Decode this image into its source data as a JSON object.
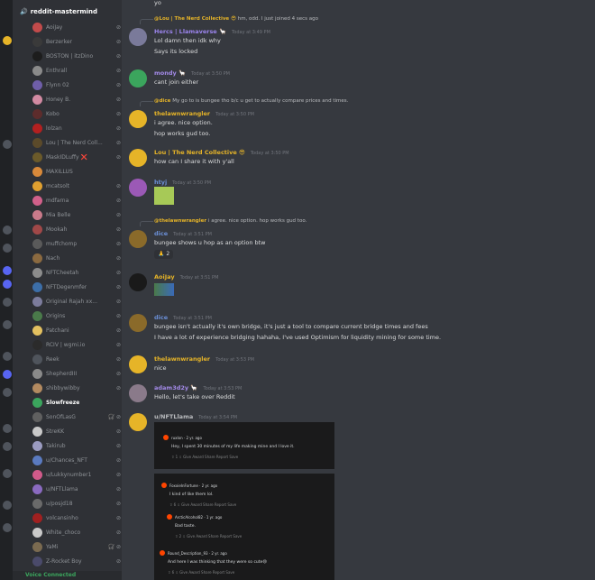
{
  "server": {
    "channel_name": "reddit-mastermind",
    "voice_users": [
      {
        "name": "AoiJay",
        "color": "#c24b4b",
        "muted": true
      },
      {
        "name": "Berzerker",
        "color": "#3a3a3a",
        "muted": true
      },
      {
        "name": "BOSTON | itzDino",
        "color": "#1d1d1d",
        "muted": true
      },
      {
        "name": "Enthrall",
        "color": "#8a8a8a",
        "muted": true
      },
      {
        "name": "Flynn 02",
        "color": "#6f5ea8",
        "muted": true
      },
      {
        "name": "Honey B.",
        "color": "#d28aa2",
        "muted": true
      },
      {
        "name": "Kobo",
        "color": "#5d2c2c",
        "muted": true
      },
      {
        "name": "lolzan",
        "color": "#b32020",
        "muted": true
      },
      {
        "name": "Lou | The Nerd Coll...",
        "color": "#5b4a2a",
        "muted": true
      },
      {
        "name": "MaskIDLuffy ❌",
        "color": "#6b5a2a",
        "muted": true
      },
      {
        "name": "MAXILLUS",
        "color": "#d8893a",
        "muted": false
      },
      {
        "name": "mcatsolt",
        "color": "#e0a030",
        "muted": true
      },
      {
        "name": "mdfarna",
        "color": "#d1608a",
        "muted": true
      },
      {
        "name": "Mia Belle",
        "color": "#c97a8a",
        "muted": true
      },
      {
        "name": "Mookah",
        "color": "#a04848",
        "muted": true
      },
      {
        "name": "muffchomp",
        "color": "#5a5a5a",
        "muted": true
      },
      {
        "name": "Nach",
        "color": "#8b6a40",
        "muted": true
      },
      {
        "name": "NFTCheetah",
        "color": "#8c8c8c",
        "muted": true
      },
      {
        "name": "NFTDegenmfer",
        "color": "#3c6ea8",
        "muted": true
      },
      {
        "name": "Original Rajah xx...",
        "color": "#7c7c9c",
        "muted": true
      },
      {
        "name": "Origins",
        "color": "#4a7a4a",
        "muted": true
      },
      {
        "name": "Patchani",
        "color": "#e3c060",
        "muted": true
      },
      {
        "name": "RCIV | wgmi.io",
        "color": "#2b2b2b",
        "muted": true
      },
      {
        "name": "Reek",
        "color": "#4f545c",
        "muted": true
      },
      {
        "name": "ShepherdIII",
        "color": "#8a8a8a",
        "muted": true
      },
      {
        "name": "shibbywibby",
        "color": "#b38a60",
        "muted": true
      },
      {
        "name": "Slowfreeze",
        "color": "#3ba55d",
        "muted": false,
        "highlight": true
      },
      {
        "name": "SonOfLasG",
        "color": "#606060",
        "muted": true,
        "deafened": true
      },
      {
        "name": "StreKK",
        "color": "#c9c9c9",
        "muted": true
      },
      {
        "name": "Takirub",
        "color": "#9b9bc0",
        "muted": true
      },
      {
        "name": "u/Chances_NFT",
        "color": "#5a7ac0",
        "muted": true
      },
      {
        "name": "u/Lukkynumber1",
        "color": "#d05a8a",
        "muted": true
      },
      {
        "name": "u/NFTLlama",
        "color": "#8a6ac0",
        "muted": true
      },
      {
        "name": "u/posjd18",
        "color": "#6a6a6a",
        "muted": true
      },
      {
        "name": "volcansinho",
        "color": "#a02020",
        "muted": true
      },
      {
        "name": "White_choco",
        "color": "#c9c9c9",
        "muted": true
      },
      {
        "name": "YaMi",
        "color": "#7a6a50",
        "muted": true,
        "deafened": true
      },
      {
        "name": "Z-Rocket Boy",
        "color": "#4a4a6a",
        "muted": true
      }
    ],
    "voice_status": "Voice Connected"
  },
  "chat": {
    "top_fragment": "yo",
    "messages": [
      {
        "reply_user": "@Lou | The Nerd Collective 😎",
        "reply_text": "hm, odd. I just joined 4 secs ago",
        "author": "Hercs | Llamaverse 🦙",
        "author_color": "#9b84ec",
        "time": "Today at 3:49 PM",
        "lines": [
          "Lol damn then idk why",
          "Says its locked"
        ]
      },
      {
        "author": "mondy 🦙",
        "author_color": "#a38ae8",
        "time": "Today at 3:50 PM",
        "lines": [
          "cant join either"
        ]
      },
      {
        "reply_user": "@dice",
        "reply_text": "My go to is bungee tho b/c u get to actually compare prices and times.",
        "author": "thelawnwrangler",
        "author_color": "#e6b428",
        "time": "Today at 3:50 PM",
        "lines": [
          "i agree. nice option.",
          "hop works gud too."
        ]
      },
      {
        "author": "Lou | The Nerd Collective 😎",
        "author_color": "#e6b428",
        "time": "Today at 3:50 PM",
        "lines": [
          "how can I share it with y'all"
        ]
      },
      {
        "author": "htyj",
        "author_color": "#6b8fd6",
        "time": "Today at 3:50 PM",
        "lines": []
      },
      {
        "reply_user": "@thelawnwrangler",
        "reply_text": "i agree. nice option.  hop works gud too.",
        "author": "dice",
        "author_color": "#6b8fd6",
        "time": "Today at 3:51 PM",
        "lines": [
          "bungee shows u hop as an option btw"
        ],
        "reaction": "🙏 2"
      },
      {
        "author": "AoiJay",
        "author_color": "#e6b428",
        "time": "Today at 3:51 PM",
        "lines": []
      },
      {
        "author": "dice",
        "author_color": "#6b8fd6",
        "time": "Today at 3:51 PM",
        "lines": [
          "bungee isn't actually it's own bridge, it's just a tool to compare current bridge times and fees",
          "I have a lot of experience bridging hahaha, I've used Optimism for liquidity mining for some time."
        ]
      },
      {
        "author": "thelawnwrangler",
        "author_color": "#e6b428",
        "time": "Today at 3:53 PM",
        "lines": [
          "nice"
        ]
      },
      {
        "author": "adam3d2y 🦙",
        "author_color": "#a38ae8",
        "time": "Today at 3:53 PM",
        "lines": [
          "Hello, let's take over Reddit"
        ]
      },
      {
        "author": "u/NFTLlama",
        "author_color": "#b9bbbe",
        "time": "Today at 3:54 PM",
        "lines": []
      }
    ],
    "embed1": {
      "user": "ruxlon",
      "meta": "· 2 yr. ago",
      "text": "Hey, I spent 30 minutes of my life making mine and I love it.",
      "votes": "1",
      "actions": "Give Award   Share   Report   Save"
    },
    "embed2": {
      "comments": [
        {
          "user": "FoxxieInFortune",
          "meta": "· 2 yr. ago",
          "text": "I kind of like them lol.",
          "votes": "6",
          "actions": "Give Award   Share   Report   Save"
        },
        {
          "user": "ArcticAlcohol82",
          "meta": "· 1 yr. ago",
          "text": "Bad taste.",
          "votes": "2",
          "actions": "Give Award   Share   Report   Save"
        },
        {
          "user": "Round_Description_93",
          "meta": "· 2 yr. ago",
          "text": "And here I was thinking that they were so cute😄",
          "votes": "6",
          "actions": "Give Award   Share   Report   Save"
        }
      ]
    }
  }
}
